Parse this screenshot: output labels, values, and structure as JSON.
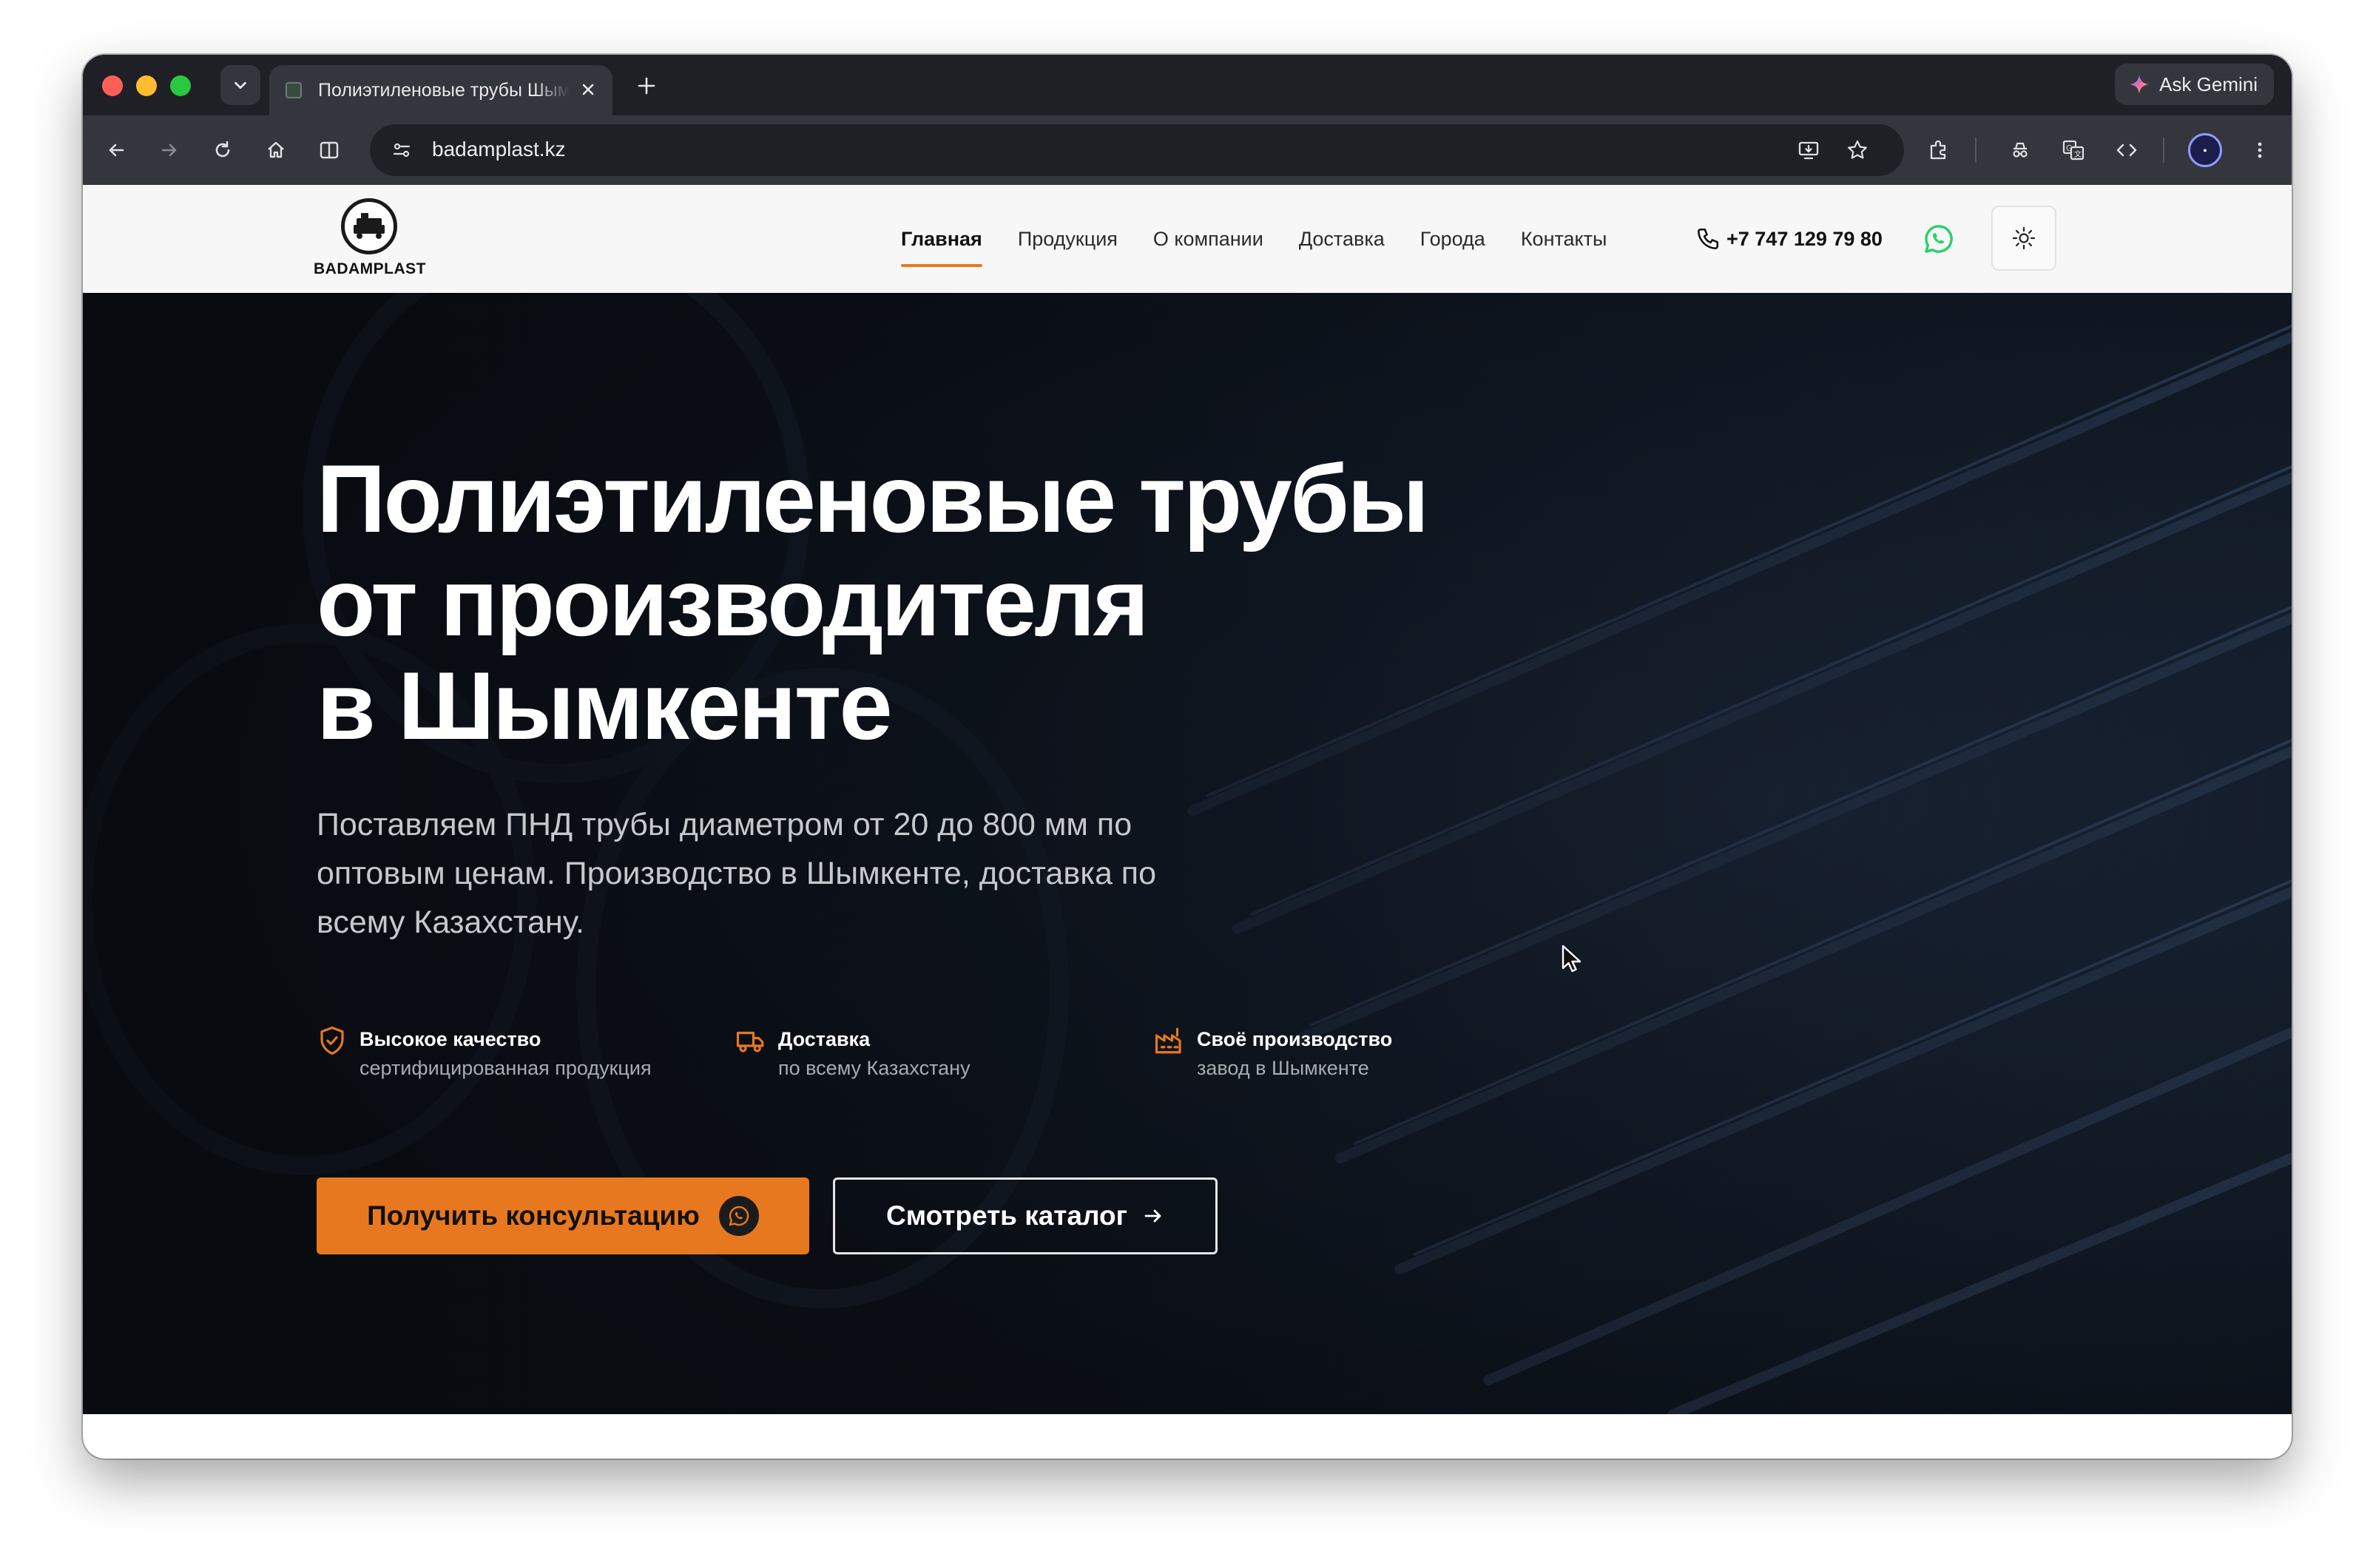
{
  "browser": {
    "tab_title": "Полиэтиленовые трубы Шымкент",
    "url": "badamplast.kz",
    "gemini_label": "Ask Gemini"
  },
  "site": {
    "logo_text": "BADAMPLAST",
    "nav": [
      {
        "label": "Главная",
        "active": true
      },
      {
        "label": "Продукция"
      },
      {
        "label": "О компании"
      },
      {
        "label": "Доставка"
      },
      {
        "label": "Города"
      },
      {
        "label": "Контакты"
      }
    ],
    "phone": "+7 747 129 79 80"
  },
  "hero": {
    "title_lines": [
      "Полиэтиленовые трубы",
      "от производителя",
      "в Шымкенте"
    ],
    "lead_lines": [
      "Поставляем ПНД трубы диаметром от 20 до 800 мм по",
      "оптовым ценам. Производство в Шымкенте, доставка по",
      "всему Казахстану."
    ],
    "features": [
      {
        "icon": "shield-check-icon",
        "title": "Высокое качество",
        "subtitle": "сертифицированная продукция"
      },
      {
        "icon": "truck-icon",
        "title": "Доставка",
        "subtitle": "по всему Казахстану"
      },
      {
        "icon": "factory-icon",
        "title": "Своё производство",
        "subtitle": "завод в Шымкенте"
      }
    ],
    "cta_primary": "Получить консультацию",
    "cta_secondary": "Смотреть каталог"
  },
  "colors": {
    "accent": "#e8781f",
    "hero_bg": "#0d1117",
    "whatsapp": "#25d366"
  }
}
